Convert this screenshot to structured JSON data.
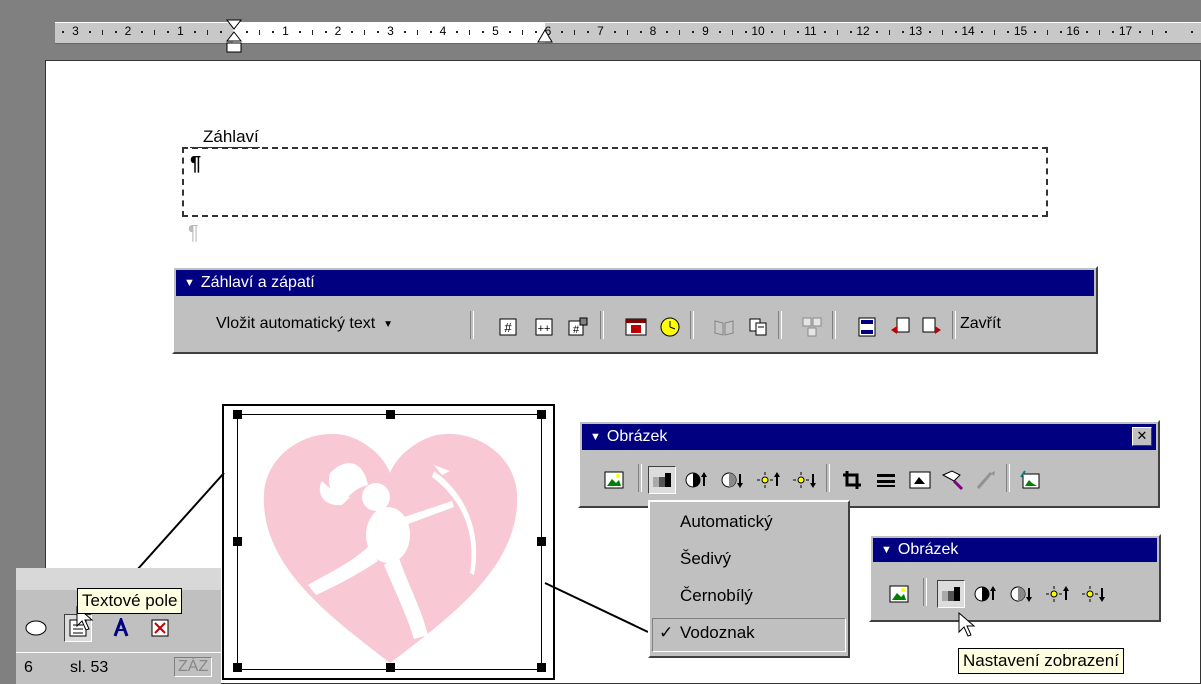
{
  "ruler": {
    "left_numbers": [
      "3",
      "2",
      "1"
    ],
    "right_numbers": [
      "1",
      "2",
      "3",
      "4",
      "5",
      "6",
      "7",
      "8",
      "9",
      "10",
      "11",
      "12",
      "13",
      "14",
      "15",
      "16",
      "17"
    ]
  },
  "header_area": {
    "label": "Záhlaví",
    "pilcrow": "¶"
  },
  "header_footer_toolbar": {
    "title": "Záhlaví a zápatí",
    "insert_autotext": "Vložit automatický text",
    "close": "Zavřít",
    "buttons": [
      "insert-page-number",
      "insert-page-count",
      "format-page-number",
      "insert-date",
      "insert-time",
      "page-setup",
      "show-hide-text",
      "same-as-previous",
      "switch-header-footer",
      "show-previous",
      "show-next"
    ]
  },
  "picture_toolbar_1": {
    "title": "Obrázek",
    "buttons": [
      "insert-picture",
      "image-control",
      "more-contrast",
      "less-contrast",
      "more-brightness",
      "less-brightness",
      "crop",
      "line-style",
      "text-wrapping",
      "format-picture",
      "set-transparent-color",
      "reset-picture"
    ]
  },
  "image_control_menu": {
    "items": [
      "Automatický",
      "Šedivý",
      "Černobílý",
      "Vodoznak"
    ],
    "checked": "Vodoznak"
  },
  "picture_toolbar_2": {
    "title": "Obrázek",
    "buttons": [
      "insert-picture",
      "image-control",
      "more-contrast",
      "less-contrast",
      "more-brightness",
      "less-brightness"
    ]
  },
  "tooltip_image_control": "Nastavení zobrazení",
  "drawing_toolbar": {
    "tooltip": "Textové pole",
    "buttons": [
      "ellipse",
      "text-box",
      "wordart",
      "clip-art"
    ]
  },
  "status_bar": {
    "page": "6",
    "section": "sl. 53",
    "mode": "ZÁZ"
  },
  "colors": {
    "title_bar": "#000080",
    "toolbar_face": "#c0c0c0",
    "heart": "#f8c8d4",
    "tooltip_bg": "#ffffe1"
  }
}
